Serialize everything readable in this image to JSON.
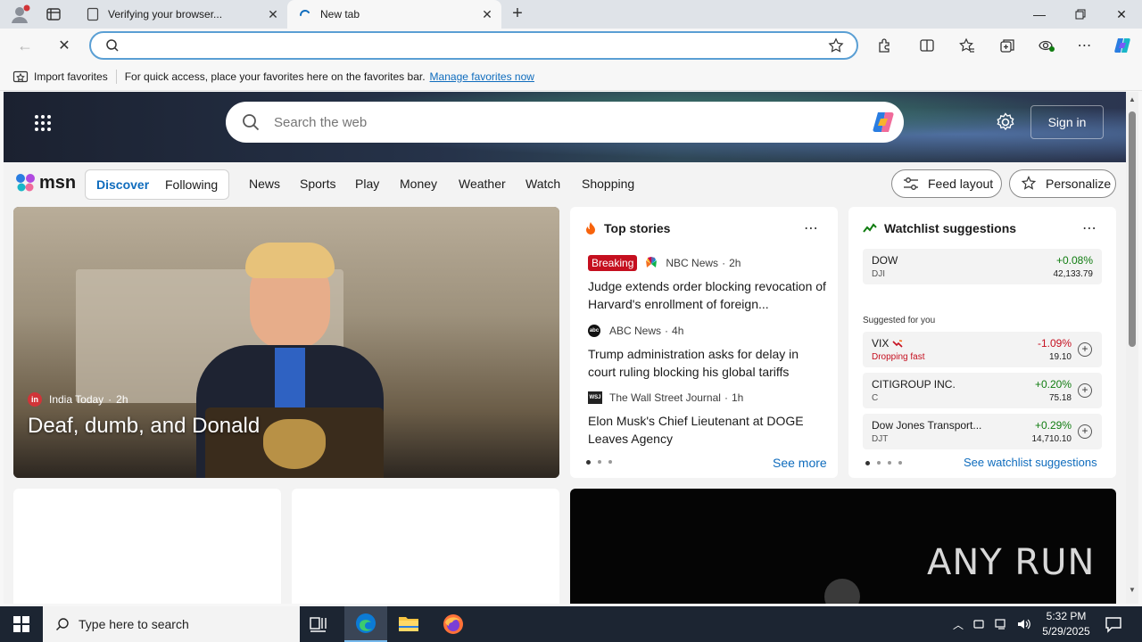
{
  "browser": {
    "tabs": [
      {
        "title": "Verifying your browser...",
        "active": false
      },
      {
        "title": "New tab",
        "active": true
      }
    ],
    "address": {
      "value": "",
      "placeholder": ""
    },
    "favorites_bar": {
      "import_label": "Import favorites",
      "message": "For quick access, place your favorites here on the favorites bar.",
      "manage_link": "Manage favorites now"
    }
  },
  "msn": {
    "search_placeholder": "Search the web",
    "sign_in": "Sign in",
    "logo_text": "msn",
    "segments": [
      "Discover",
      "Following"
    ],
    "nav": [
      "News",
      "Sports",
      "Play",
      "Money",
      "Weather",
      "Watch",
      "Shopping"
    ],
    "feed_layout": "Feed layout",
    "personalize": "Personalize",
    "hero": {
      "source": "India Today",
      "age": "2h",
      "title": "Deaf, dumb, and Donald"
    },
    "top_stories": {
      "title": "Top stories",
      "breaking_badge": "Breaking",
      "stories": [
        {
          "source": "NBC News",
          "age": "2h",
          "headline": "Judge extends order blocking revocation of Harvard's enrollment of foreign..."
        },
        {
          "source": "ABC News",
          "age": "4h",
          "headline": "Trump administration asks for delay in court ruling blocking his global tariffs"
        },
        {
          "source": "The Wall Street Journal",
          "age": "1h",
          "headline": "Elon Musk's Chief Lieutenant at DOGE Leaves Agency"
        }
      ],
      "see_more": "See more",
      "more_icon": "ellipsis-icon"
    },
    "watchlist": {
      "title": "Watchlist suggestions",
      "primary": {
        "name": "DOW",
        "symbol": "DJI",
        "change": "+0.08%",
        "price": "42,133.79"
      },
      "suggested_label": "Suggested for you",
      "suggested": [
        {
          "name": "VIX",
          "symbol": "Dropping fast",
          "change": "-1.09%",
          "price": "19.10",
          "negative": true
        },
        {
          "name": "CITIGROUP INC.",
          "symbol": "C",
          "change": "+0.20%",
          "price": "75.18",
          "negative": false
        },
        {
          "name": "Dow Jones Transport...",
          "symbol": "DJT",
          "change": "+0.29%",
          "price": "14,710.10",
          "negative": false
        }
      ],
      "see_all": "See watchlist suggestions"
    },
    "watermark": "ANY RUN"
  },
  "taskbar": {
    "search_placeholder": "Type here to search",
    "time": "5:32 PM",
    "date": "5/29/2025"
  },
  "colors": {
    "accent": "#0f6cbd",
    "positive": "#107c10",
    "negative": "#c50f1f",
    "breaking": "#c50f1f",
    "taskbar": "#1c2532"
  }
}
